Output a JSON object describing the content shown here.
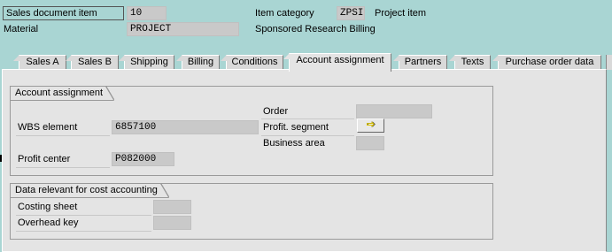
{
  "header": {
    "sales_doc_item_label": "Sales document item",
    "sales_doc_item_value": "10",
    "item_category_label": "Item category",
    "item_category_value": "ZPSI",
    "item_category_desc": "Project item",
    "material_label": "Material",
    "material_value": "PROJECT",
    "material_desc": "Sponsored Research Billing"
  },
  "tabs": [
    {
      "label": "Sales A"
    },
    {
      "label": "Sales B"
    },
    {
      "label": "Shipping"
    },
    {
      "label": "Billing"
    },
    {
      "label": "Conditions"
    },
    {
      "label": "Account assignment"
    },
    {
      "label": "Partners"
    },
    {
      "label": "Texts"
    },
    {
      "label": "Purchase order data"
    }
  ],
  "account_assignment": {
    "title": "Account assignment",
    "order_label": "Order",
    "order_value": "",
    "wbs_label": "WBS element",
    "wbs_value": "6857100",
    "profit_segment_label": "Profit. segment",
    "business_area_label": "Business area",
    "business_area_value": "",
    "profit_center_label": "Profit center",
    "profit_center_value": "P082000"
  },
  "cost_accounting": {
    "title": "Data relevant for cost accounting",
    "costing_sheet_label": "Costing sheet",
    "costing_sheet_value": "",
    "overhead_key_label": "Overhead key",
    "overhead_key_value": ""
  },
  "colors": {
    "background": "#a9d5d3",
    "panel": "#e4e4e4",
    "field": "#c9c9c9"
  }
}
